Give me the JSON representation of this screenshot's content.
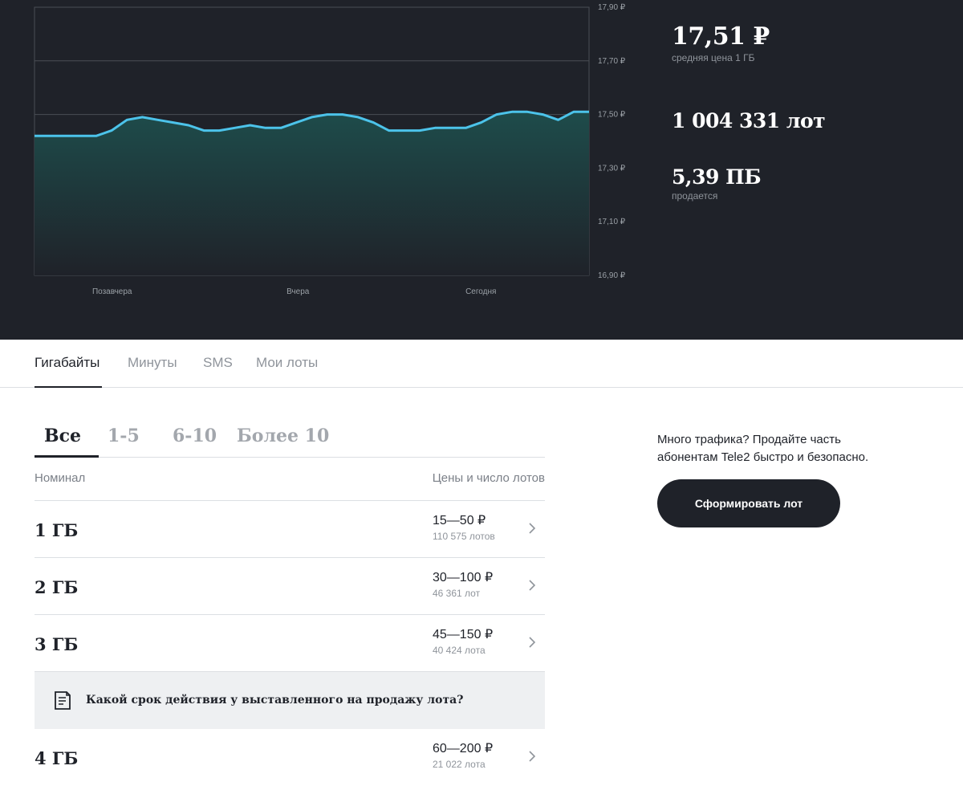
{
  "chart_data": {
    "type": "area",
    "x_ticks": [
      "Позавчера",
      "Вчера",
      "Сегодня"
    ],
    "y_ticks": [
      "17,90 ₽",
      "17,70 ₽",
      "17,50 ₽",
      "17,30 ₽",
      "17,10 ₽",
      "16,90 ₽"
    ],
    "ylim": [
      16.9,
      17.9
    ],
    "grid": true,
    "values": [
      17.42,
      17.42,
      17.42,
      17.42,
      17.42,
      17.44,
      17.48,
      17.49,
      17.48,
      17.47,
      17.46,
      17.44,
      17.44,
      17.45,
      17.46,
      17.45,
      17.45,
      17.47,
      17.49,
      17.5,
      17.5,
      17.49,
      17.47,
      17.44,
      17.44,
      17.44,
      17.45,
      17.45,
      17.45,
      17.47,
      17.5,
      17.51,
      17.51,
      17.5,
      17.48,
      17.51,
      17.51
    ],
    "colors": {
      "line": "#4cc3ea",
      "fill_top": "#1e4c4b",
      "fill_bottom": "#1f2229",
      "grid": "#4a4e55",
      "tick_text": "#9aa0a6"
    }
  },
  "stats": {
    "avg_price": "17,51 ₽",
    "avg_price_caption": "средняя цена 1 ГБ",
    "lots": "1 004 331 лот",
    "selling": "5,39 ПБ",
    "selling_caption": "продается"
  },
  "main_tabs": [
    {
      "label": "Гигабайты",
      "active": true
    },
    {
      "label": "Минуты",
      "active": false
    },
    {
      "label": "SMS",
      "active": false
    },
    {
      "label": "Мои лоты",
      "active": false
    }
  ],
  "sub_tabs": [
    {
      "label": "Все",
      "active": true
    },
    {
      "label": "1-5",
      "active": false
    },
    {
      "label": "6-10",
      "active": false
    },
    {
      "label": "Более 10",
      "active": false
    }
  ],
  "table": {
    "header_left": "Номинал",
    "header_right": "Цены и число лотов",
    "rows": [
      {
        "title": "1 ГБ",
        "price": "15—50 ₽",
        "lots": "110 575 лотов"
      },
      {
        "title": "2 ГБ",
        "price": "30—100 ₽",
        "lots": "46 361 лот"
      },
      {
        "title": "3 ГБ",
        "price": "45—150 ₽",
        "lots": "40 424 лота"
      },
      {
        "title": "4 ГБ",
        "price": "60—200 ₽",
        "lots": "21 022 лота"
      }
    ]
  },
  "faq": {
    "text": "Какой срок действия у выставленного на продажу лота?"
  },
  "promo": {
    "line1": "Много трафика? Продайте часть",
    "line2": "абонентам Tele2 быстро и безопасно.",
    "button": "Сформировать лот"
  },
  "icons": {
    "chevron": "chevron-right-icon",
    "faq": "document-icon"
  }
}
